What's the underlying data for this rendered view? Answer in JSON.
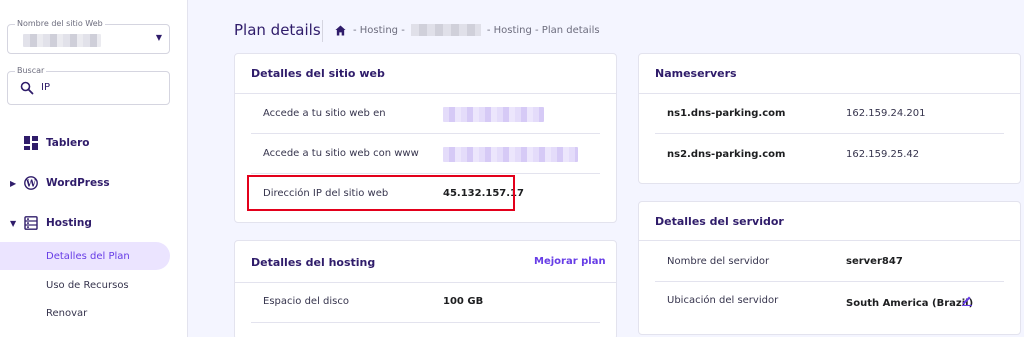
{
  "sidebar": {
    "site_select": {
      "legend": "Nombre del sitio Web",
      "value": ""
    },
    "search": {
      "legend": "Buscar",
      "value": "IP"
    },
    "nav": [
      {
        "label": "Tablero",
        "icon": "dashboard-icon"
      },
      {
        "label": "WordPress",
        "icon": "wordpress-icon"
      },
      {
        "label": "Hosting",
        "icon": "hosting-icon"
      }
    ],
    "hosting_sub": [
      {
        "label": "Detalles del Plan",
        "active": true
      },
      {
        "label": "Uso de Recursos",
        "active": false
      },
      {
        "label": "Renovar",
        "active": false
      }
    ]
  },
  "header": {
    "title": "Plan details",
    "breadcrumb": {
      "part1": "- Hosting -",
      "part2": "- Hosting - Plan details"
    }
  },
  "website_card": {
    "title": "Detalles del sitio web",
    "rows": [
      {
        "label": "Accede a tu sitio web en",
        "value": ""
      },
      {
        "label": "Accede a tu sitio web con www",
        "value": ""
      },
      {
        "label": "Dirección IP del sitio web",
        "value": "45.132.157.17"
      }
    ]
  },
  "hosting_card": {
    "title": "Detalles del hosting",
    "upgrade_link": "Mejorar plan",
    "rows": [
      {
        "label": "Espacio del disco",
        "value": "100 GB"
      }
    ]
  },
  "nameservers_card": {
    "title": "Nameservers",
    "rows": [
      {
        "name": "ns1.dns-parking.com",
        "ip": "162.159.24.201"
      },
      {
        "name": "ns2.dns-parking.com",
        "ip": "162.159.25.42"
      }
    ]
  },
  "server_card": {
    "title": "Detalles del servidor",
    "rows": [
      {
        "label": "Nombre del servidor",
        "value": "server847"
      },
      {
        "label": "Ubicación del servidor",
        "value": "South America (Brazil)"
      }
    ]
  },
  "colors": {
    "accent": "#673de6",
    "highlight": "#e3001b",
    "text": "#2f1c6a",
    "background": "#f4f5ff"
  }
}
